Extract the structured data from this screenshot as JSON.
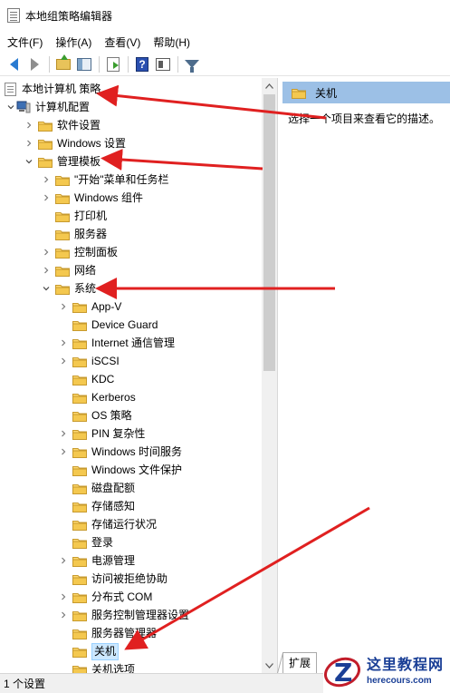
{
  "window": {
    "title": "本地组策略编辑器"
  },
  "menu": {
    "items": [
      "文件(F)",
      "操作(A)",
      "查看(V)",
      "帮助(H)"
    ]
  },
  "toolbar": {
    "buttons": [
      "back-icon",
      "forward-icon",
      "up-folder-icon",
      "show-hide-tree-icon",
      "export-list-icon",
      "help-icon",
      "view-icon",
      "filter-icon"
    ]
  },
  "tree": {
    "root": "本地计算机 策略",
    "computer_config": "计算机配置",
    "software_settings": "软件设置",
    "windows_settings": "Windows 设置",
    "admin_templates": "管理模板",
    "start_menu": "\"开始\"菜单和任务栏",
    "windows_components": "Windows 组件",
    "printers": "打印机",
    "server": "服务器",
    "control_panel": "控制面板",
    "network": "网络",
    "system": "系统",
    "system_children": [
      "App-V",
      "Device Guard",
      "Internet 通信管理",
      "iSCSI",
      "KDC",
      "Kerberos",
      "OS 策略",
      "PIN 复杂性",
      "Windows 时间服务",
      "Windows 文件保护",
      "磁盘配额",
      "存储感知",
      "存储运行状况",
      "登录",
      "电源管理",
      "访问被拒绝协助",
      "分布式 COM",
      "服务控制管理器设置",
      "服务器管理器",
      "关机",
      "关机选项"
    ]
  },
  "detail": {
    "header": "关机",
    "description": "选择一个项目来查看它的描述。",
    "tab": "扩展"
  },
  "status": {
    "text": "1 个设置"
  },
  "watermark": {
    "title": "这里教程网",
    "url": "herecours.com"
  },
  "colors": {
    "folder": "#e8c35a",
    "selection": "#cce8ff",
    "header": "#9cc0e6",
    "arrow": "#e02020",
    "watermark": "#1a3f96"
  }
}
